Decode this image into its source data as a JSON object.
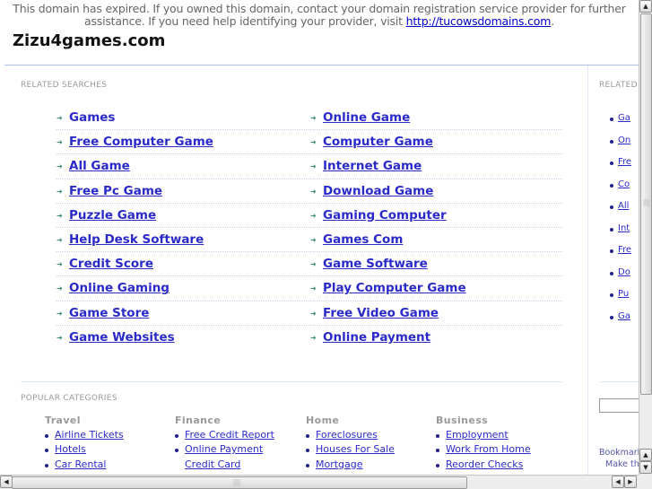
{
  "notice": {
    "text": "This domain has expired. If you owned this domain, contact your domain registration service provider for further assistance. If you need help identifying your provider, visit ",
    "link": "http://tucowsdomains.com",
    "suffix": "."
  },
  "site_title": "Zizu4games.com",
  "related_searches": {
    "label": "RELATED SEARCHES",
    "left": [
      "Games",
      "Free Computer Game",
      "All Game",
      "Free Pc Game",
      "Puzzle Game",
      "Help Desk Software",
      "Credit Score",
      "Online Gaming",
      "Game Store",
      "Game Websites"
    ],
    "right": [
      "Online Game",
      "Computer Game",
      "Internet Game",
      "Download Game",
      "Gaming Computer",
      "Games Com",
      "Game Software",
      "Play Computer Game",
      "Free Video Game",
      "Online Payment"
    ]
  },
  "popular_categories": {
    "label": "POPULAR CATEGORIES",
    "columns": [
      {
        "heading": "Travel",
        "links": [
          "Airline Tickets",
          "Hotels",
          "Car Rental"
        ]
      },
      {
        "heading": "Finance",
        "links": [
          "Free Credit Report",
          "Online Payment",
          "Credit Card"
        ]
      },
      {
        "heading": "Home",
        "links": [
          "Foreclosures",
          "Houses For Sale",
          "Mortgage"
        ]
      },
      {
        "heading": "Business",
        "links": [
          "Employment",
          "Work From Home",
          "Reorder Checks"
        ]
      }
    ]
  },
  "side_panel": {
    "label": "RELATED",
    "links": [
      "Ga",
      "On",
      "Fre",
      "Co",
      "All",
      "Int",
      "Fre",
      "Do",
      "Pu",
      "Ga"
    ],
    "bookmark_line1": "Bookmark",
    "bookmark_line2": "Make thi"
  },
  "scrollbars": {
    "up": "▲",
    "down": "▼",
    "left": "◀",
    "right": "▶"
  }
}
